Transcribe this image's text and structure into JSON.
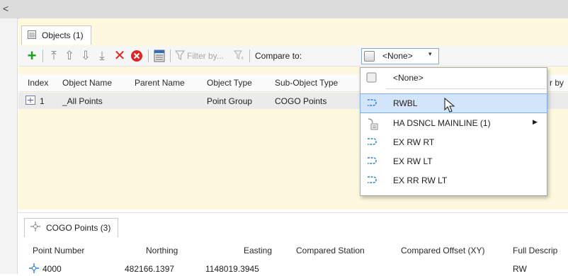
{
  "scroll": {
    "left_arrow": "<"
  },
  "objects_tab": {
    "label": "Objects (1)"
  },
  "toolbar": {
    "add": "+",
    "move_top": "⤒",
    "move_up": "⇧",
    "move_down": "⇩",
    "move_bottom": "⤓",
    "delete": "✕",
    "filter_placeholder": "Filter by...",
    "compare_label": "Compare to:",
    "compare_value": "<None>"
  },
  "objects_table": {
    "columns": [
      "Index",
      "Object Name",
      "Parent Name",
      "Object Type",
      "Sub-Object Type",
      "r by"
    ],
    "rows": [
      {
        "index": "1",
        "object_name": "_All Points",
        "parent_name": "",
        "object_type": "Point Group",
        "sub_object_type": "COGO Points"
      }
    ]
  },
  "compare_dropdown": {
    "items": [
      {
        "label": "<None>",
        "icon": "blank-object-icon",
        "selected": false,
        "submenu": false
      },
      {
        "label": "RWBL",
        "icon": "alignment-icon",
        "selected": true,
        "submenu": false
      },
      {
        "label": "HA DSNCL MAINLINE (1)",
        "icon": "site-icon",
        "selected": false,
        "submenu": true
      },
      {
        "label": "EX RW RT",
        "icon": "alignment-icon",
        "selected": false,
        "submenu": false
      },
      {
        "label": "EX RW LT",
        "icon": "alignment-icon",
        "selected": false,
        "submenu": false
      },
      {
        "label": "EX RR RW LT",
        "icon": "alignment-icon",
        "selected": false,
        "submenu": false
      }
    ]
  },
  "cogo_tab": {
    "label": "COGO Points (3)"
  },
  "cogo_table": {
    "columns": [
      "Point Number",
      "Northing",
      "Easting",
      "Compared Station",
      "Compared Offset (XY)",
      "Full Descrip"
    ],
    "rows": [
      {
        "point_number": "4000",
        "northing": "482166.1397",
        "easting": "1148019.3945",
        "station": "",
        "offset": "",
        "description": "RW"
      }
    ]
  },
  "colors": {
    "accent": "#7fb0e6",
    "panel": "#fdf8de",
    "add": "#1aa01a",
    "delete": "#e02424"
  }
}
